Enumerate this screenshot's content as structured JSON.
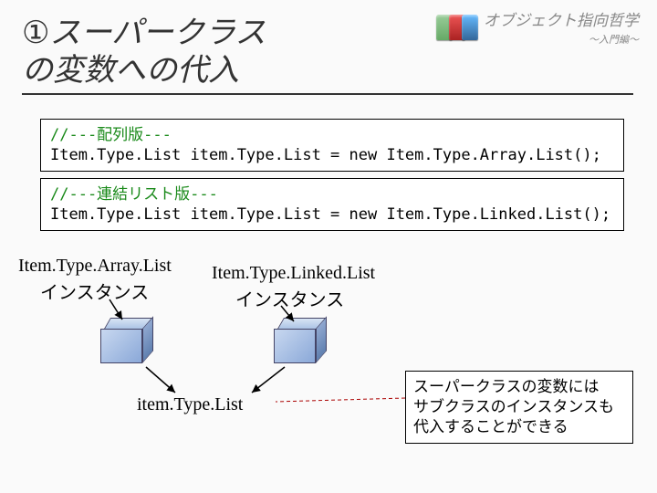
{
  "header": {
    "title": "オブジェクト指向哲学",
    "subtitle": "～入門編～"
  },
  "slide": {
    "number": "①",
    "title_line1": "スーパークラス",
    "title_line2": "の変数への代入"
  },
  "code": {
    "box1_comment": "//---配列版---",
    "box1_code": "Item.Type.List item.Type.List = new Item.Type.Array.List();",
    "box2_comment": "//---連結リスト版---",
    "box2_code": "Item.Type.List item.Type.List = new Item.Type.Linked.List();"
  },
  "labels": {
    "array_class": "Item.Type.Array.List",
    "instance_jp": "インスタンス",
    "linked_class": "Item.Type.Linked.List",
    "item_var": "item.Type.List"
  },
  "note": {
    "line1": "スーパークラスの変数には",
    "line2": "サブクラスのインスタンスも",
    "line3": "代入することができる"
  }
}
